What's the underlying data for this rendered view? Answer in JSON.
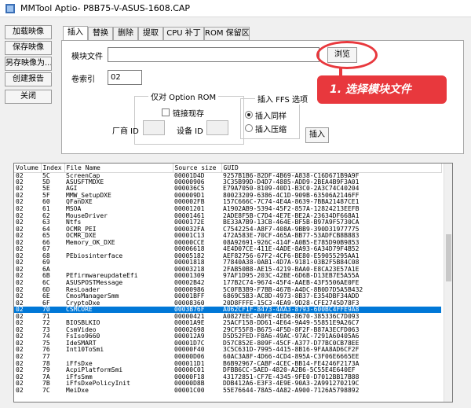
{
  "window": {
    "title": "MMTool Aptio- P8B75-V-ASUS-1608.CAP"
  },
  "left_buttons": [
    {
      "label": "加载映像"
    },
    {
      "label": "保存映像"
    },
    {
      "label": "另存映像为..."
    },
    {
      "label": "创建报告"
    },
    {
      "label": "关闭"
    }
  ],
  "tabs": [
    {
      "label": "插入"
    },
    {
      "label": "替换"
    },
    {
      "label": "删除"
    },
    {
      "label": "提取"
    },
    {
      "label": "CPU 补丁"
    },
    {
      "label": "ROM 保留区"
    }
  ],
  "insert_panel": {
    "module_file_label": "模块文件",
    "module_file_value": "",
    "browse_label": "浏览",
    "volume_index_label": "卷索引",
    "volume_index_value": "02",
    "option_rom_group": "仅对 Option ROM",
    "link_present_label": "链接现存",
    "vendor_id_label": "厂商 ID",
    "device_id_label": "设备 ID",
    "ffs_group": "插入 FFS 选项",
    "insert_as_is_label": "插入同样",
    "insert_compressed_label": "插入压缩",
    "insert_button_label": "插入"
  },
  "annotation": {
    "text": "1. 选择模块文件",
    "color": "#e8383d"
  },
  "table": {
    "headers": [
      "Volume",
      "Index",
      "File Name",
      "Source size",
      "GUID"
    ],
    "selected_index": 20,
    "rows": [
      [
        "02",
        "5C",
        "ScreenCap",
        "00001D4D",
        "9257B1B6-82DF-4B69-A838-C16D671B9A9F"
      ],
      [
        "02",
        "5D",
        "ASUSFTMDXE",
        "00000906",
        "3C35B99D-D4D7-4885-ADD9-2BEA4B9F3A01"
      ],
      [
        "02",
        "5E",
        "AGI",
        "000036C5",
        "E79A7050-8109-40D1-B3C0-2A3C74C40204"
      ],
      [
        "02",
        "5F",
        "MMW_SetupDXE",
        "000009D1",
        "80023209-6386-4C1D-909B-63506A2146FF"
      ],
      [
        "02",
        "60",
        "QFanDXE",
        "000002FB",
        "157C666C-7C74-4E4A-8639-7BBA21487CE1"
      ],
      [
        "02",
        "61",
        "MSOA",
        "00001201",
        "A1902AB9-5394-45F2-857A-12824213EEFB"
      ],
      [
        "02",
        "62",
        "MouseDriver",
        "00001461",
        "2ADE8F5B-C7D4-4E7E-BE2A-23634DF668A1"
      ],
      [
        "02",
        "63",
        "Ntfs",
        "0000172E",
        "BE33A7B9-13CB-464E-BF5B-B97A9F5730CA"
      ],
      [
        "02",
        "64",
        "OCMR_PEI",
        "000032FA",
        "C7542254-A8F7-408A-9BB9-390D31977775"
      ],
      [
        "02",
        "65",
        "OCMR_DXE",
        "00001C13",
        "472A583E-70CF-465A-BB77-53ADFCB8B883"
      ],
      [
        "02",
        "66",
        "Memory_OK_DXE",
        "00000CCE",
        "08A92691-926C-414F-A0B5-E785D90B9853"
      ],
      [
        "02",
        "67",
        "",
        "00006618",
        "4E4D07CE-411E-4ADE-8A93-6A34D79F4B52"
      ],
      [
        "02",
        "68",
        "PEbiosinterface",
        "00005182",
        "AEF82756-67F2-4CF6-BE80-E59055295AA1"
      ],
      [
        "02",
        "69",
        "",
        "00001818",
        "77840A38-0AB1-4D7A-9181-03B2F5B84C08"
      ],
      [
        "02",
        "6A",
        "",
        "00003218",
        "2FAB50B8-AE15-4219-BAA0-E8CA23E57A1E"
      ],
      [
        "02",
        "6B",
        "PEfirmwareupdateEfi",
        "00001309",
        "97AF1D95-203C-42BE-6D6B-D13EB7E5A55A"
      ],
      [
        "02",
        "6C",
        "ASUSPOSTMessage",
        "00002B42",
        "177B2C74-9674-45F4-AAEB-43F5506AE0FE"
      ],
      [
        "02",
        "6D",
        "ResLoader",
        "00000986",
        "5C0FB3B9-F7BB-467B-A4DC-8B0D7D5A5B432"
      ],
      [
        "02",
        "6E",
        "CmosManagerSmm",
        "00001BFF",
        "6869C5B3-AC8D-4973-8B37-E354DBF34ADD"
      ],
      [
        "02",
        "6F",
        "CryptoDxe",
        "00008360",
        "20D8FFFE-15C3-4EA9-9D28-CFE2745D78F3"
      ],
      [
        "02",
        "70",
        "CSMCORE",
        "0003B76F",
        "A062CF1F-8473-4AA3-8793-600BC4FFE9A8"
      ],
      [
        "02",
        "71",
        "",
        "00000421",
        "A0827EEC-A0FE-4ED6-8670-385336C7D093"
      ],
      [
        "02",
        "72",
        "BIOSBLKIO",
        "00001A9E",
        "25ACF158-DD61-4E64-9A49-55851E9A26C7"
      ],
      [
        "02",
        "73",
        "CsmVideo",
        "00002698",
        "29CF55F8-B675-4F5D-8F2F-B87A3ECFD063"
      ],
      [
        "02",
        "74",
        "FsIso9660",
        "000012A9",
        "D5D52FED-F8A6-49AC-97AC-7291A60405A6"
      ],
      [
        "02",
        "75",
        "IdeSMART",
        "00001D7C",
        "D57C852E-809F-45CF-A377-D77BC0CB78EE"
      ],
      [
        "02",
        "76",
        "Int10ToSmi",
        "00000F40",
        "3C5C631D-7995-4415-8B16-9FAA8AD6CF2F"
      ],
      [
        "02",
        "77",
        "",
        "00000D06",
        "60AC3A8F-4D66-4CD4-895A-C3F06E6665EE"
      ],
      [
        "02",
        "78",
        "iFfsDxe",
        "000011D1",
        "B6B92967-CABF-4CEC-BB14-FE4246F2173A"
      ],
      [
        "02",
        "79",
        "AcpiPlatformSmi",
        "00000C01",
        "DFBB6CC-5AED-4820-A2B6-5C55E4E640EF"
      ],
      [
        "02",
        "7A",
        "iFfsSmm",
        "00000F18",
        "43172851-CF7E-4345-9FE0-D7012BB17B88"
      ],
      [
        "02",
        "7B",
        "iFfsDxePolicyInit",
        "00000D8B",
        "DDB412A6-E3F3-4E9E-90A3-2A991270219C"
      ],
      [
        "02",
        "7C",
        "MeiDxe",
        "00001C00",
        "55E76644-78A5-4A82-A900-7126A5798892"
      ]
    ]
  }
}
